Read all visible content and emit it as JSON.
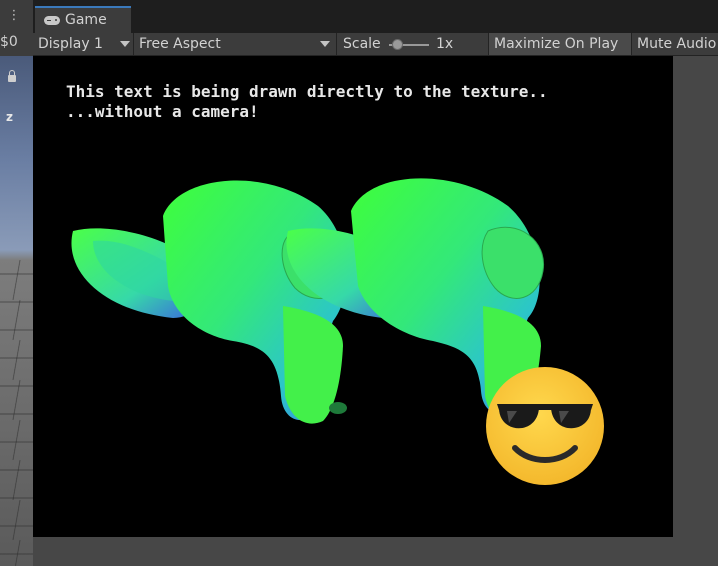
{
  "scene_sliver": {
    "menu_icon": "vertical-dots-icon",
    "left_text": "$0",
    "axis_label": "z"
  },
  "tab": {
    "label": "Game",
    "icon": "gamepad-icon"
  },
  "toolbar": {
    "display": "Display 1",
    "aspect": "Free Aspect",
    "scale_label": "Scale",
    "scale_value": "1x",
    "scale_level": 0.1,
    "maximize": "Maximize On Play",
    "mute": "Mute Audio"
  },
  "viewport": {
    "overlay_line1": "This text is being drawn directly to the texture..",
    "overlay_line2": "...without a camera!",
    "background": "#000000",
    "objects": [
      "suzanne-monkey-head",
      "suzanne-monkey-head",
      "sunglasses-emoji"
    ]
  },
  "colors": {
    "tab_accent": "#3a79bb",
    "panel": "#3c3c3c",
    "game_bg": "#474747",
    "emoji_yellow": "#f7c53a"
  }
}
